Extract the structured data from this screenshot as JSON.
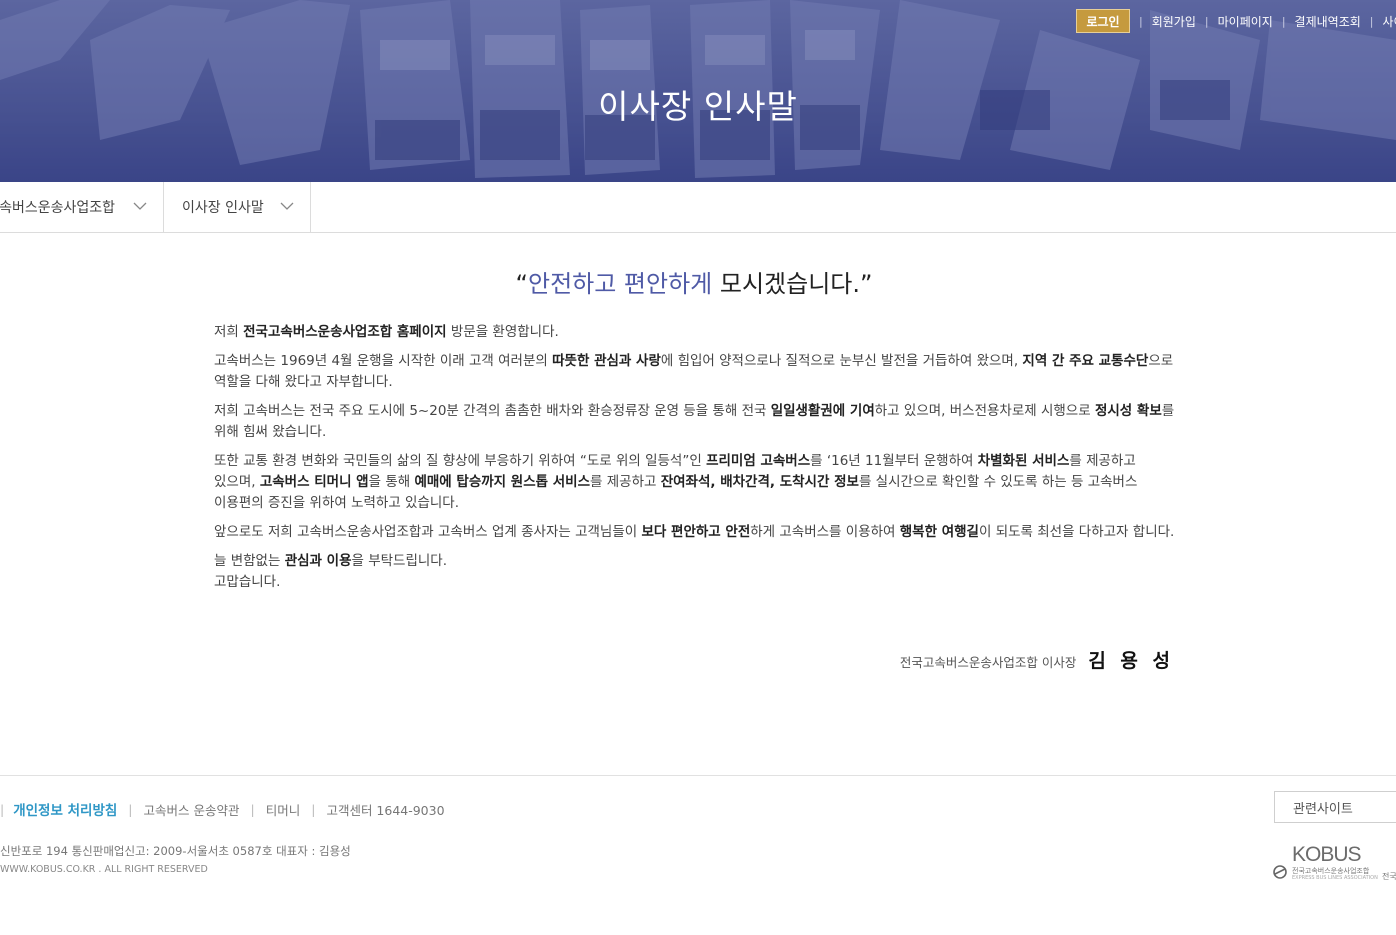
{
  "hero": {
    "title": "이사장 인사말"
  },
  "util_nav": {
    "login": "로그인",
    "links": [
      "회원가입",
      "마이페이지",
      "결제내역조회",
      "사이트"
    ]
  },
  "subnav": {
    "item1": "고속버스운송사업조합",
    "item2": "이사장 인사말"
  },
  "headline": {
    "open_quote": "“",
    "accent": "안전하고 편안하게",
    "rest": " 모시겠습니다.",
    "close_quote": "”"
  },
  "greeting": {
    "p1": [
      {
        "t": "저희 "
      },
      {
        "t": "전국고속버스운송사업조합 홈페이지",
        "b": true
      },
      {
        "t": " 방문을 환영합니다."
      }
    ],
    "p2": [
      {
        "t": "고속버스는 1969년 4월 운행을 시작한 이래 고객 여러분의 "
      },
      {
        "t": "따뜻한 관심과 사랑",
        "b": true
      },
      {
        "t": "에 힘입어 양적으로나 질적으로 눈부신 발전을 거듭하여 왔으며, "
      },
      {
        "t": "지역 간 주요 교통수단",
        "b": true
      },
      {
        "t": "으로 역할을 다해 왔다고 자부합니다."
      }
    ],
    "p3": [
      {
        "t": "저희 고속버스는 전국 주요 도시에 5~20분 간격의 촘촘한 배차와 환승정류장 운영 등을 통해 전국 "
      },
      {
        "t": "일일생활권에 기여",
        "b": true
      },
      {
        "t": "하고 있으며, 버스전용차로제 시행으로 "
      },
      {
        "t": "정시성 확보",
        "b": true
      },
      {
        "t": "를 위해 힘써 왔습니다."
      }
    ],
    "p4": [
      {
        "t": "또한 교통 환경 변화와 국민들의 삶의 질 향상에 부응하기 위하여 “도로 위의 일등석”인 "
      },
      {
        "t": "프리미엄 고속버스",
        "b": true
      },
      {
        "t": "를 ‘16년 11월부터 운행하여 "
      },
      {
        "t": "차별화된 서비스",
        "b": true
      },
      {
        "t": "를 제공하고 있으며, "
      },
      {
        "t": "고속버스 티머니 앱",
        "b": true
      },
      {
        "t": "을 통해 "
      },
      {
        "t": "예매에 탑승까지 원스톱 서비스",
        "b": true
      },
      {
        "t": "를 제공하고 "
      },
      {
        "t": "잔여좌석, 배차간격, 도착시간 정보",
        "b": true
      },
      {
        "t": "를 실시간으로 확인할 수 있도록 하는 등 고속버스 이용편의 증진을 위하여 노력하고 있습니다."
      }
    ],
    "p5": [
      {
        "t": "앞으로도 저희 고속버스운송사업조합과 고속버스 업계 종사자는 고객님들이 "
      },
      {
        "t": "보다 편안하고 안전",
        "b": true
      },
      {
        "t": "하게 고속버스를 이용하여 "
      },
      {
        "t": "행복한 여행길",
        "b": true
      },
      {
        "t": "이 되도록 최선을 다하고자 합니다."
      }
    ],
    "p6": [
      {
        "t": "늘 변함없는 "
      },
      {
        "t": "관심과 이용",
        "b": true
      },
      {
        "t": "을 부탁드립니다."
      },
      {
        "br": true
      },
      {
        "t": "고맙습니다."
      }
    ]
  },
  "signature": {
    "org": "전국고속버스운송사업조합 이사장",
    "name": "김 용 성"
  },
  "footer": {
    "privacy": "개인정보 처리방침",
    "terms": "고속버스 운송약관",
    "tmoney": "티머니",
    "customer_center": "고객센터 1644-9030",
    "related_sites": "관련사이트",
    "address": "신반포로 194 통신판매업신고: 2009-서울서초 0587호 대표자 : 김용성",
    "copyright": "WWW.KOBUS.CO.KR . ALL RIGHT RESERVED",
    "logo_word": "KOBUS",
    "logo_sub": "전국고속버스운송사업조합",
    "logo_sub2": "EXPRESS BUS LINES ASSOCIATION",
    "edge_text": "전국"
  },
  "colors": {
    "hero_tint": "#4a5591",
    "login_button": "#c59a3e",
    "headline_accent": "#4f5aa6",
    "privacy_link": "#2f97c6"
  },
  "icons": {
    "subnav_toggle": "chevron-down-icon",
    "logo_mark": "bus-logo-mark-icon"
  }
}
